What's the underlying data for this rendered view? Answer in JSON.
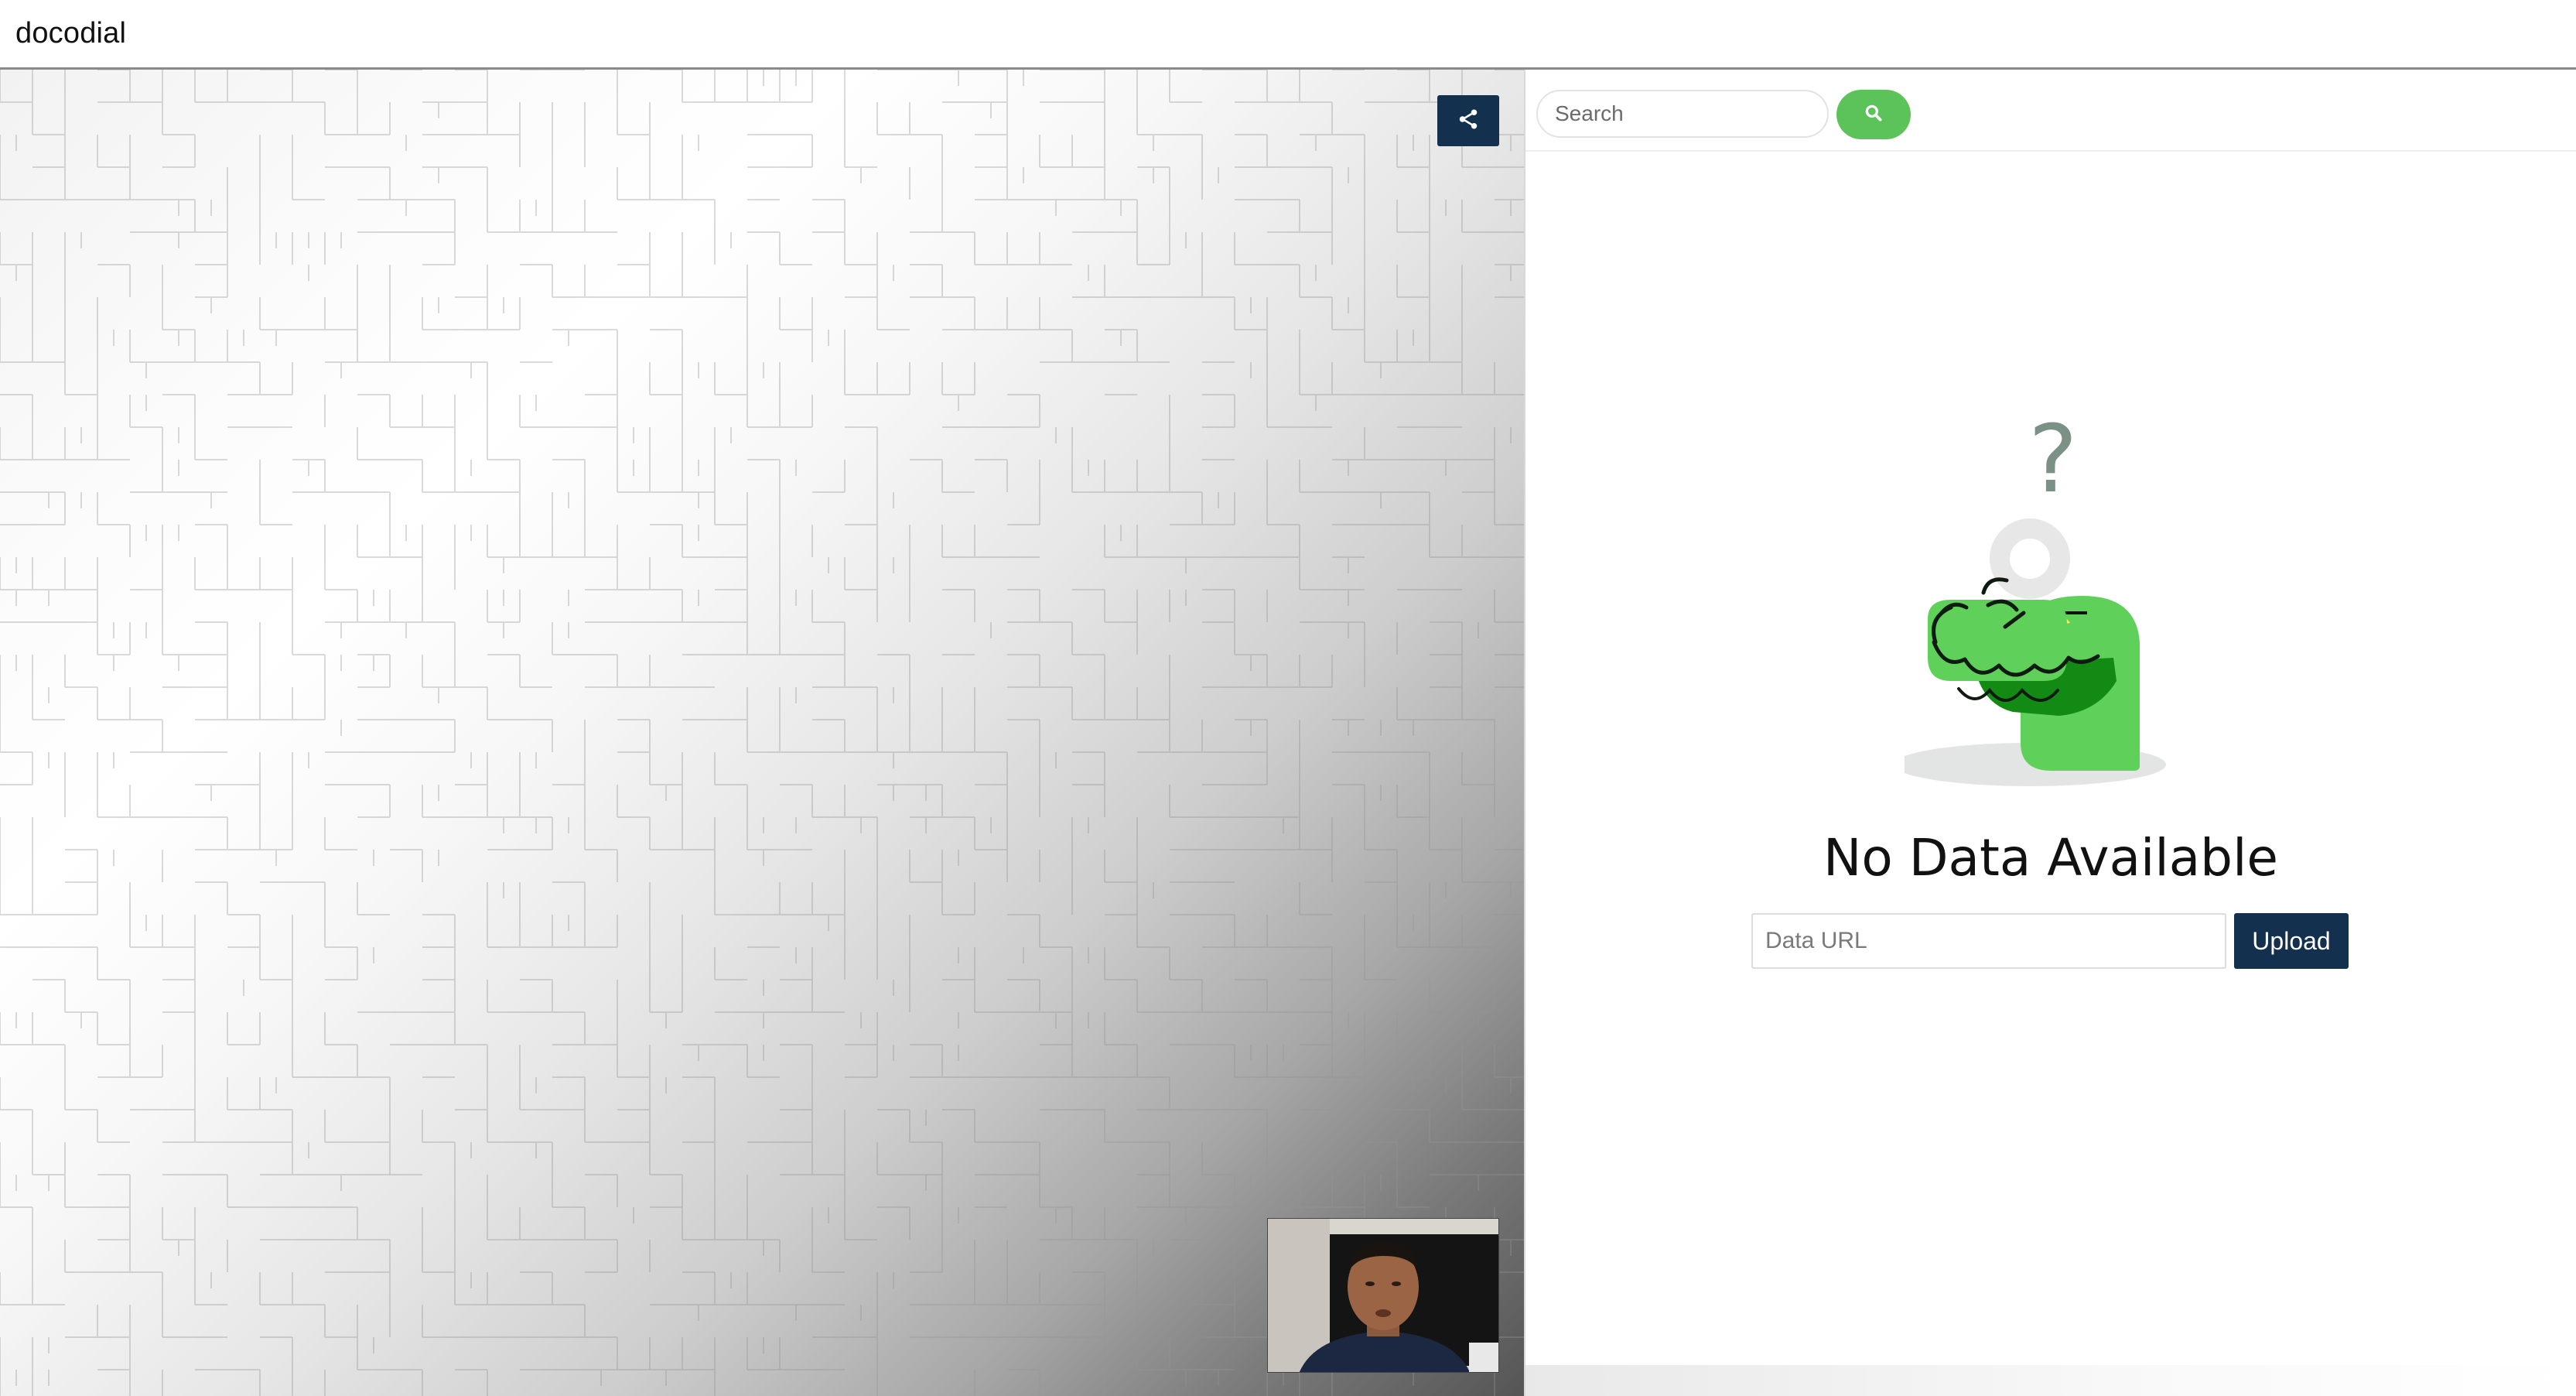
{
  "app": {
    "title": "docodial"
  },
  "canvas": {
    "share_icon": "share-icon",
    "share_button_color": "#14304f"
  },
  "video": {
    "icon": "participant-video"
  },
  "search": {
    "placeholder": "Search",
    "value": "",
    "button_icon": "search-icon",
    "button_color": "#5cc25a"
  },
  "empty_state": {
    "illustration_glyph": "?",
    "title": "No Data Available"
  },
  "upload": {
    "url_placeholder": "Data URL",
    "url_value": "",
    "button_label": "Upload",
    "button_color": "#14304f"
  }
}
